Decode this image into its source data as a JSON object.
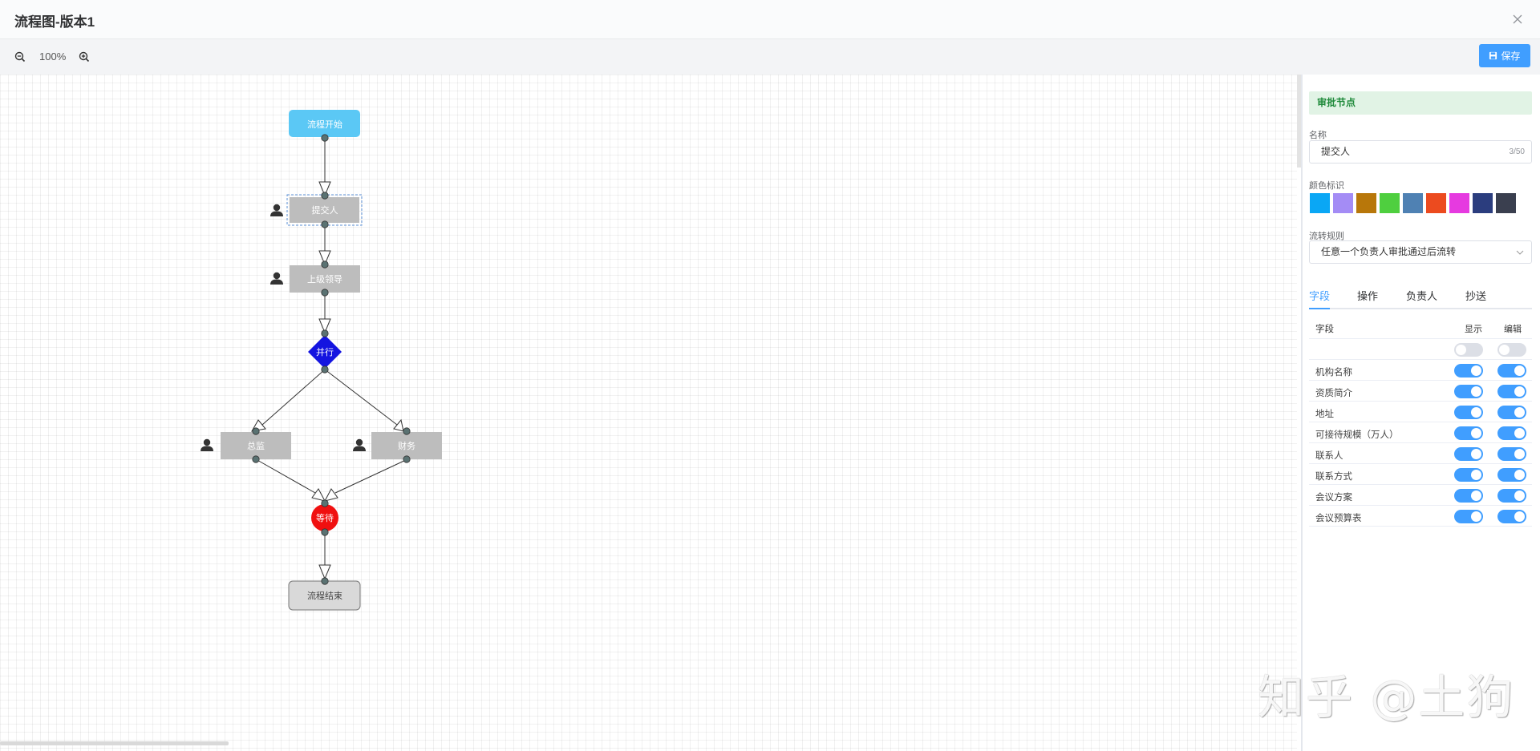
{
  "header": {
    "title": "流程图-版本1"
  },
  "toolbar": {
    "zoom": "100%",
    "save_label": "保存"
  },
  "flow": {
    "nodes": {
      "start": "流程开始",
      "submitter": "提交人",
      "manager": "上级领导",
      "parallel": "并行",
      "director": "总监",
      "finance": "财务",
      "wait": "等待",
      "end": "流程结束"
    }
  },
  "panel": {
    "node_type": "审批节点",
    "name_label": "名称",
    "name_value": "提交人",
    "name_counter": "3/50",
    "color_label": "颜色标识",
    "colors": [
      "#0aa7f5",
      "#a48cf5",
      "#b8770a",
      "#4fcf3f",
      "#4f81b3",
      "#ec4b1f",
      "#e63ae0",
      "#2b3d7e",
      "#3a3f4f"
    ],
    "rule_label": "流转规则",
    "rule_value": "任意一个负责人审批通过后流转",
    "tabs": [
      "字段",
      "操作",
      "负责人",
      "抄送"
    ],
    "fields": {
      "header": {
        "name": "字段",
        "show": "显示",
        "edit": "编辑"
      },
      "rows": [
        {
          "name": "",
          "show": false,
          "edit": false
        },
        {
          "name": "机构名称",
          "show": true,
          "edit": true
        },
        {
          "name": "资质简介",
          "show": true,
          "edit": true
        },
        {
          "name": "地址",
          "show": true,
          "edit": true
        },
        {
          "name": "可接待规模（万人）",
          "show": true,
          "edit": true
        },
        {
          "name": "联系人",
          "show": true,
          "edit": true
        },
        {
          "name": "联系方式",
          "show": true,
          "edit": true
        },
        {
          "name": "会议方案",
          "show": true,
          "edit": true
        },
        {
          "name": "会议预算表",
          "show": true,
          "edit": true
        }
      ]
    }
  },
  "watermark": "知乎 @土狗"
}
